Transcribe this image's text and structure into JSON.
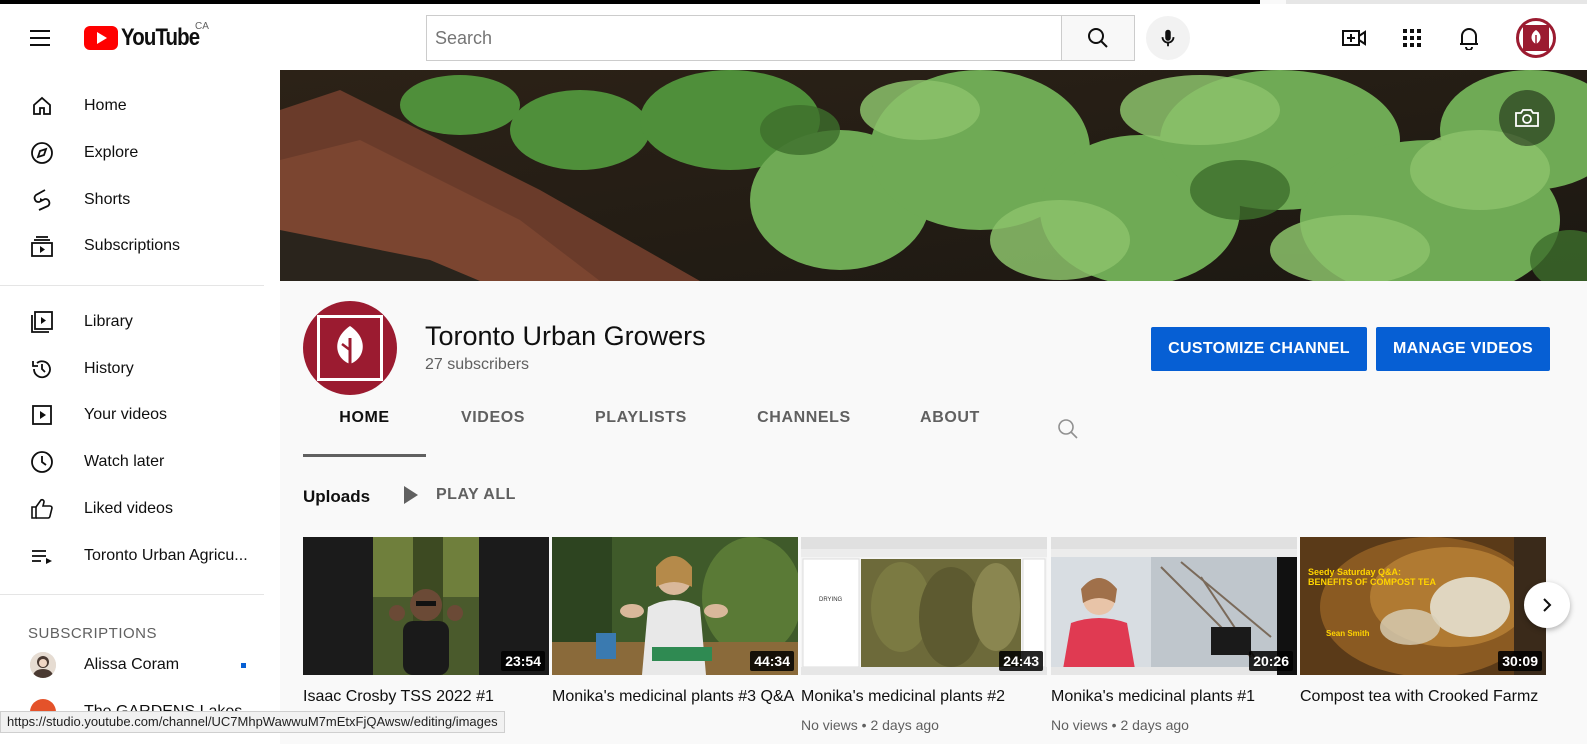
{
  "header": {
    "logo_text": "YouTube",
    "country_code": "CA",
    "search_placeholder": "Search"
  },
  "sidebar": {
    "items": [
      {
        "label": "Home",
        "icon": "home-icon"
      },
      {
        "label": "Explore",
        "icon": "compass-icon"
      },
      {
        "label": "Shorts",
        "icon": "shorts-icon"
      },
      {
        "label": "Subscriptions",
        "icon": "subscriptions-icon"
      },
      {
        "label": "Library",
        "icon": "library-icon"
      },
      {
        "label": "History",
        "icon": "history-icon"
      },
      {
        "label": "Your videos",
        "icon": "your-videos-icon"
      },
      {
        "label": "Watch later",
        "icon": "clock-icon"
      },
      {
        "label": "Liked videos",
        "icon": "thumbs-up-icon"
      },
      {
        "label": "Toronto Urban Agricu...",
        "icon": "playlist-icon"
      }
    ],
    "subscriptions_title": "SUBSCRIPTIONS",
    "subscriptions": [
      {
        "name": "Alissa Coram"
      },
      {
        "name": "The GARDENS Lakes"
      }
    ]
  },
  "channel": {
    "name": "Toronto Urban Growers",
    "subscribers": "27 subscribers",
    "customize_label": "CUSTOMIZE CHANNEL",
    "manage_label": "MANAGE VIDEOS",
    "tabs": [
      "HOME",
      "VIDEOS",
      "PLAYLISTS",
      "CHANNELS",
      "ABOUT"
    ],
    "brand_color": "#9b1b30"
  },
  "uploads": {
    "title": "Uploads",
    "play_all": "PLAY ALL",
    "videos": [
      {
        "title": "Isaac Crosby TSS 2022 #1",
        "duration": "23:54",
        "meta": ""
      },
      {
        "title": "Monika's medicinal plants #3 Q&A",
        "duration": "44:34",
        "meta": ""
      },
      {
        "title": "Monika's medicinal plants #2",
        "duration": "24:43",
        "meta": "No views • 2 days ago"
      },
      {
        "title": "Monika's medicinal plants #1",
        "duration": "20:26",
        "meta": "No views • 2 days ago"
      },
      {
        "title": "Compost tea with Crooked Farmz",
        "duration": "30:09",
        "meta": ""
      }
    ],
    "thumb5_caption_1": "Seedy Saturday Q&A:",
    "thumb5_caption_2": "BENEFITS OF COMPOST TEA",
    "thumb5_author": "Sean Smith",
    "thumb3_label": "DRYING"
  },
  "status_url": "https://studio.youtube.com/channel/UC7MhpWawwuM7mEtxFjQAwsw/editing/images"
}
